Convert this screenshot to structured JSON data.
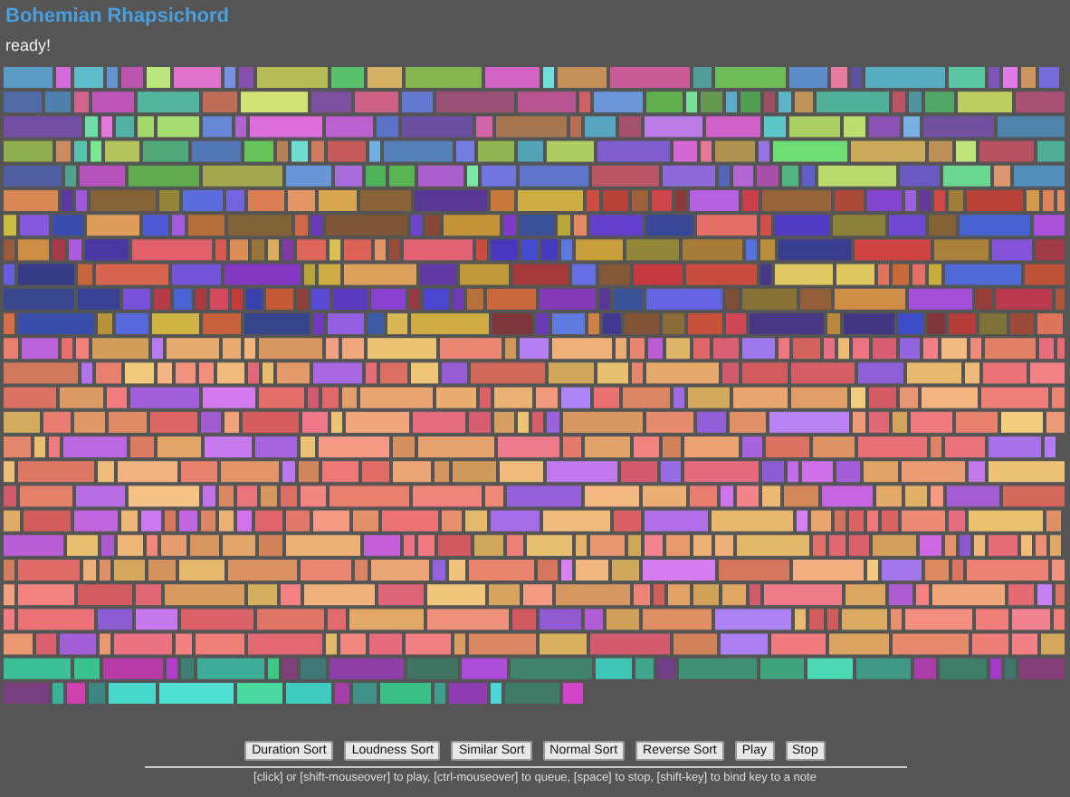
{
  "title": "Bohemian Rhapsichord",
  "status": "ready!",
  "buttons": [
    "Duration Sort",
    "Loudness Sort",
    "Similar Sort",
    "Normal Sort",
    "Reverse Sort",
    "Play",
    "Stop"
  ],
  "hint": "[click] or [shift-mouseover] to play, [ctrl-mouseover] to queue, [space] to stop, [shift-key] to bind key to a note"
}
